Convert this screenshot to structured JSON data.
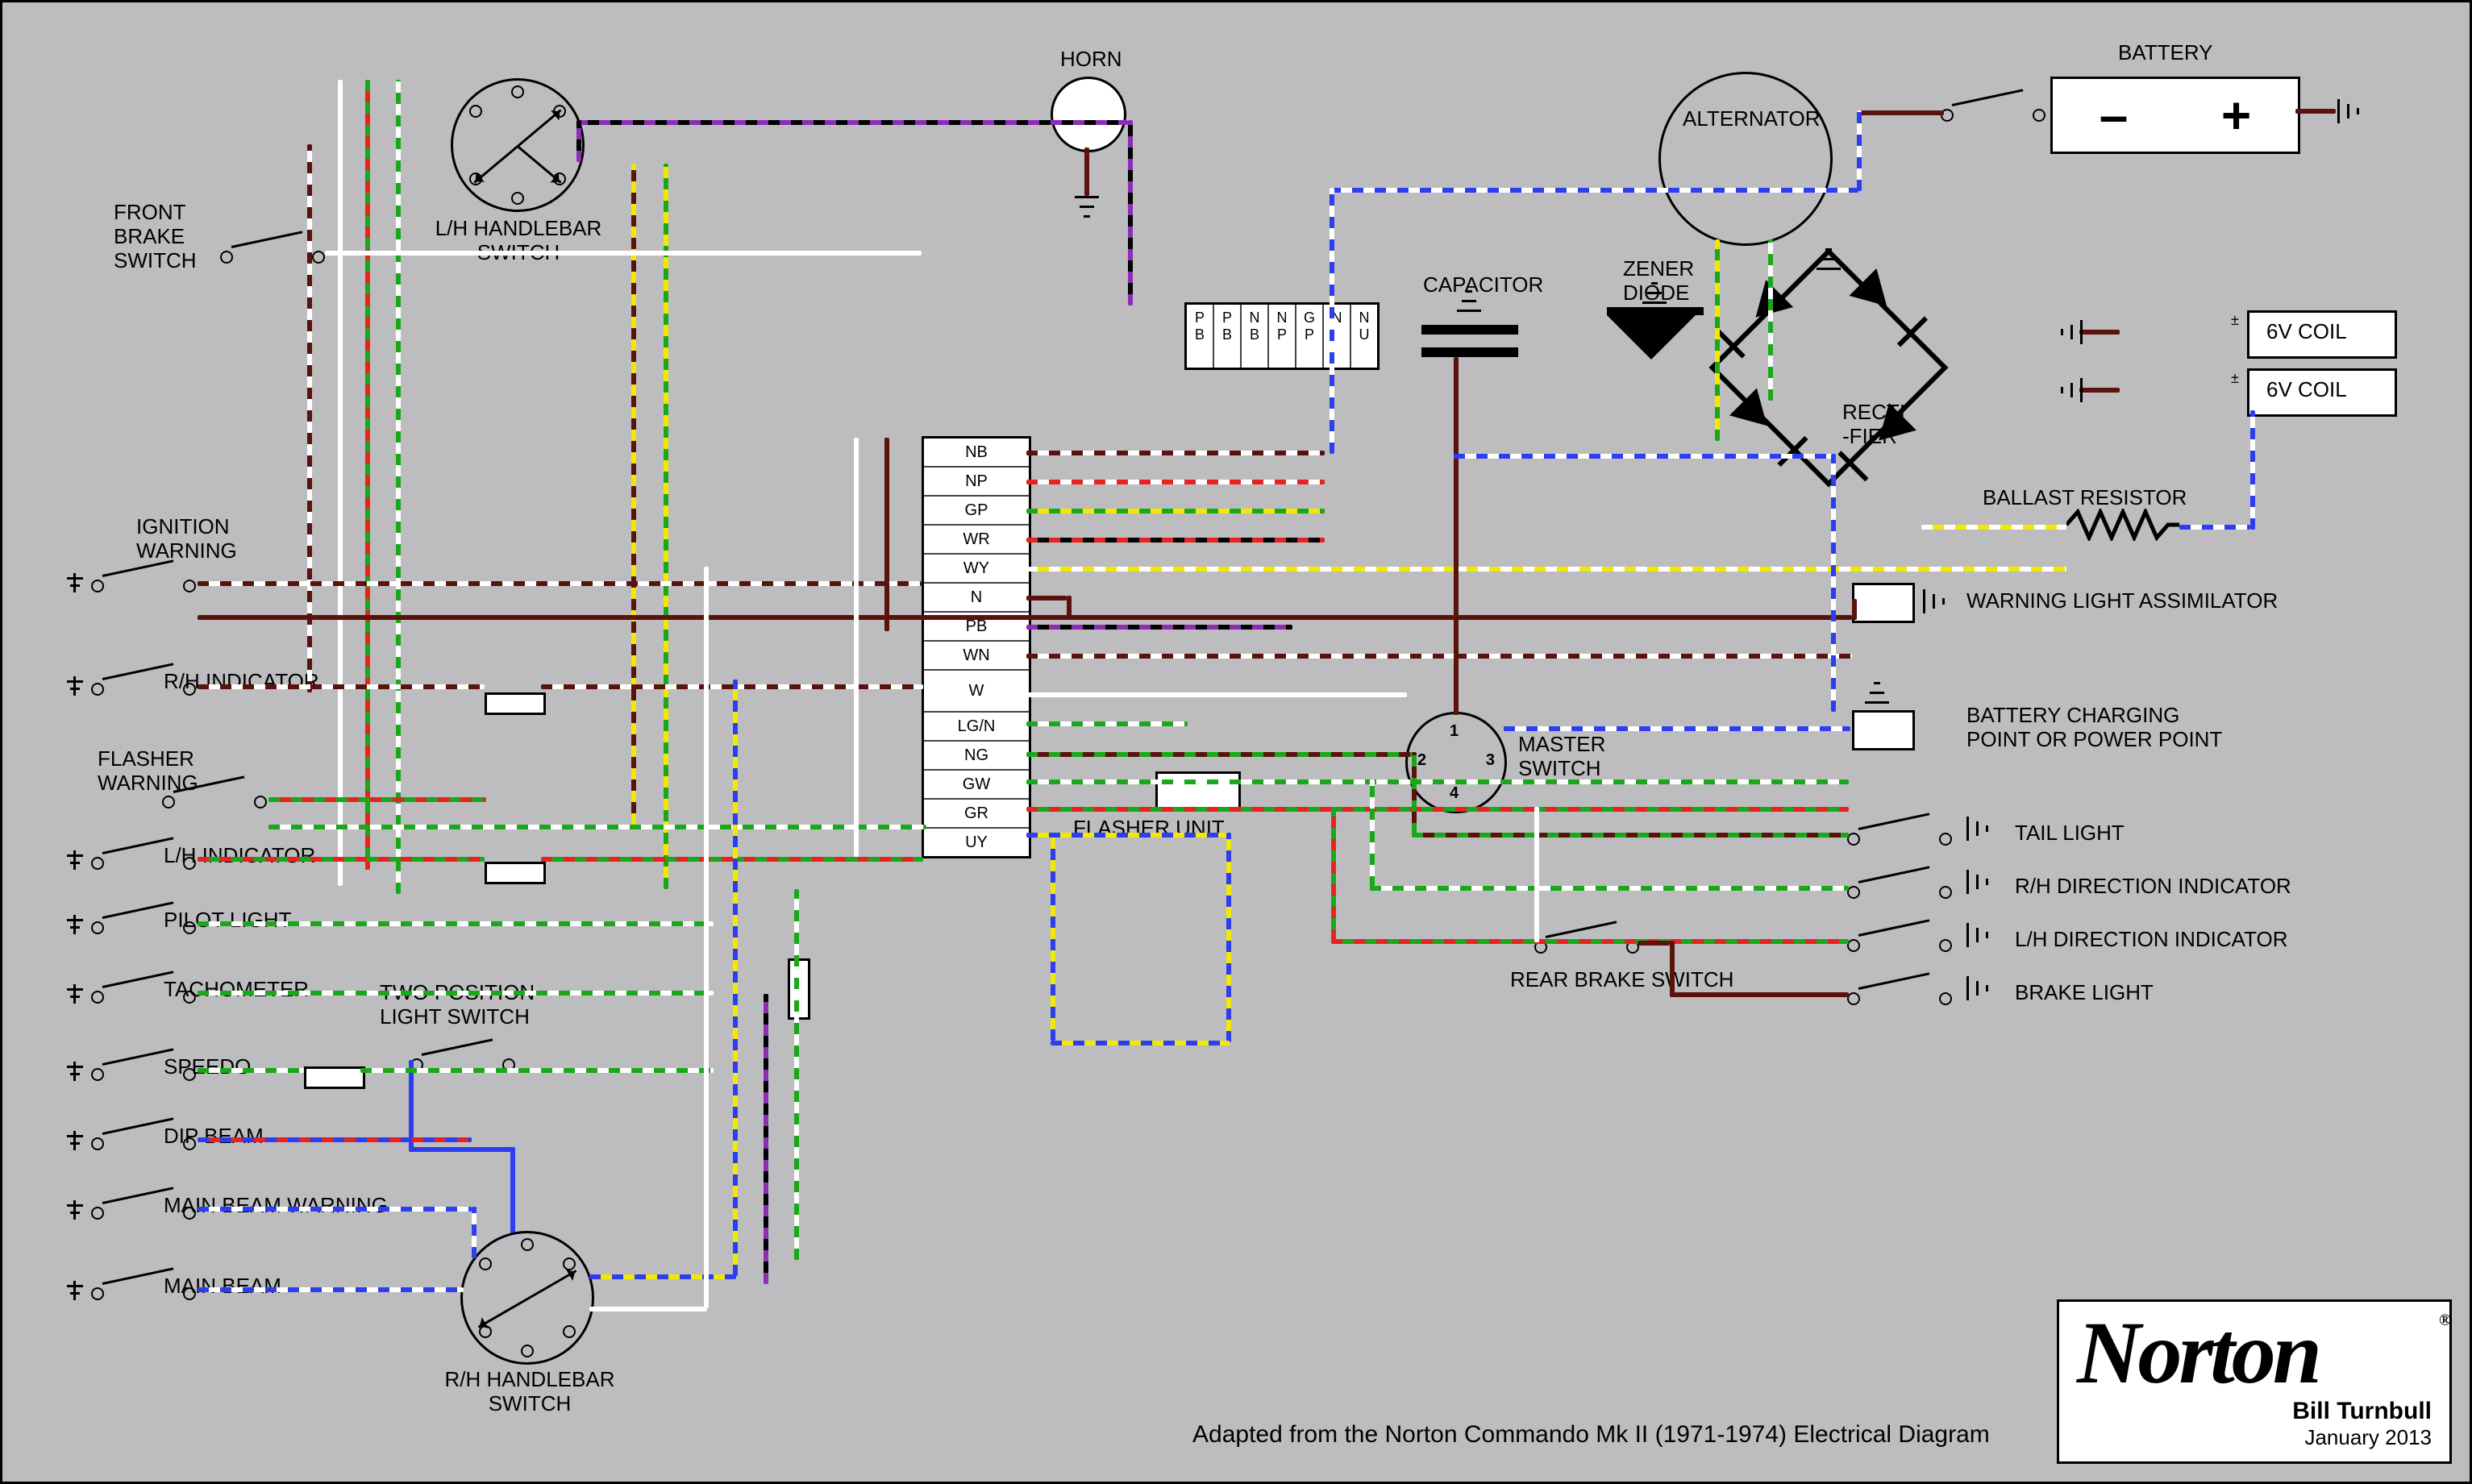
{
  "caption": "Adapted from the Norton Commando Mk II (1971-1974) Electrical Diagram",
  "logo": {
    "text": "Norton",
    "reg": "®"
  },
  "author": "Bill Turnbull",
  "date": "January 2013",
  "components": {
    "horn": "HORN",
    "alternator": "ALTERNATOR",
    "battery": "BATTERY",
    "capacitor": "CAPACITOR",
    "zener": "ZENER\nDIODE",
    "rectifier": "RECTI\n-FIER",
    "coil1": "6V COIL",
    "coil2": "6V COIL",
    "ballast": "BALLAST RESISTOR",
    "assimilator": "WARNING LIGHT ASSIMILATOR",
    "charge_point": "BATTERY CHARGING\nPOINT OR POWER POINT",
    "master": "MASTER\nSWITCH",
    "flasher_unit": "FLASHER UNIT",
    "rear_brake": "REAR BRAKE SWITCH",
    "lh_handlebar": "L/H HANDLEBAR\nSWITCH",
    "rh_handlebar": "R/H HANDLEBAR\nSWITCH",
    "two_pos": "TWO POSITION\nLIGHT SWITCH"
  },
  "left_terms": [
    "FRONT\nBRAKE\nSWITCH",
    "IGNITION\nWARNING",
    "R/H INDICATOR",
    "FLASHER\nWARNING",
    "L/H INDICATOR",
    "PILOT LIGHT",
    "TACHOMETER",
    "SPEEDO",
    "DIP BEAM",
    "MAIN BEAM WARNING",
    "MAIN BEAM"
  ],
  "right_terms": [
    "TAIL LIGHT",
    "R/H DIRECTION INDICATOR",
    "L/H DIRECTION INDICATOR",
    "BRAKE LIGHT"
  ],
  "horn_conn": [
    "P\nB",
    "P\nB",
    "N\nB",
    "N\nP",
    "G\nP",
    "N",
    "N\nU"
  ],
  "main_conn": [
    "NB",
    "NP",
    "GP",
    "WR",
    "WY",
    "N",
    "PB",
    "WN",
    "W",
    "LG/N",
    "NG",
    "GW",
    "GR",
    "UY"
  ],
  "master_nums": [
    "1",
    "2",
    "3",
    "4"
  ],
  "battery_poles": {
    "neg": "–",
    "pos": "+"
  }
}
